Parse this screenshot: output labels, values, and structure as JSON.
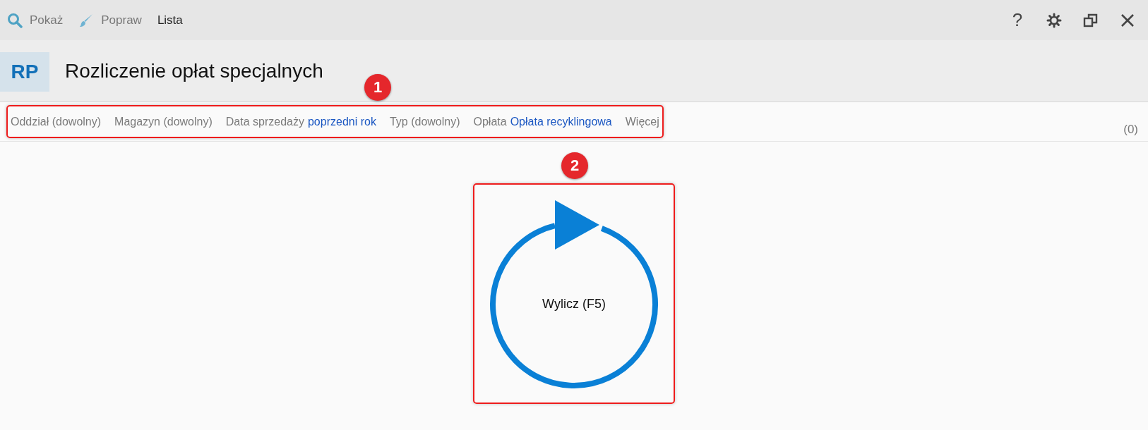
{
  "toolbar": [
    {
      "kind": "search",
      "label": "Pokaż",
      "selected": false
    },
    {
      "kind": "brush",
      "label": "Popraw",
      "selected": false
    },
    {
      "kind": "plain",
      "label": "Lista",
      "selected": true
    }
  ],
  "window_controls": [
    {
      "kind": "help",
      "label": "?"
    },
    {
      "kind": "settings"
    },
    {
      "kind": "restore"
    },
    {
      "kind": "close"
    }
  ],
  "header": {
    "badge": "RP",
    "title": "Rozliczenie opłat specjalnych"
  },
  "filters": [
    {
      "label": "Oddział (dowolny)"
    },
    {
      "label": "Magazyn (dowolny)"
    },
    {
      "label": "Data sprzedaży",
      "value": "poprzedni rok"
    },
    {
      "label": "Typ (dowolny)"
    },
    {
      "label": "Opłata",
      "value": "Opłata recyklingowa"
    },
    {
      "label": "Więcej"
    }
  ],
  "count": "(0)",
  "calculate_button": {
    "label": "Wylicz (F5)"
  },
  "annotations": [
    {
      "number": "1"
    },
    {
      "number": "2"
    }
  ]
}
